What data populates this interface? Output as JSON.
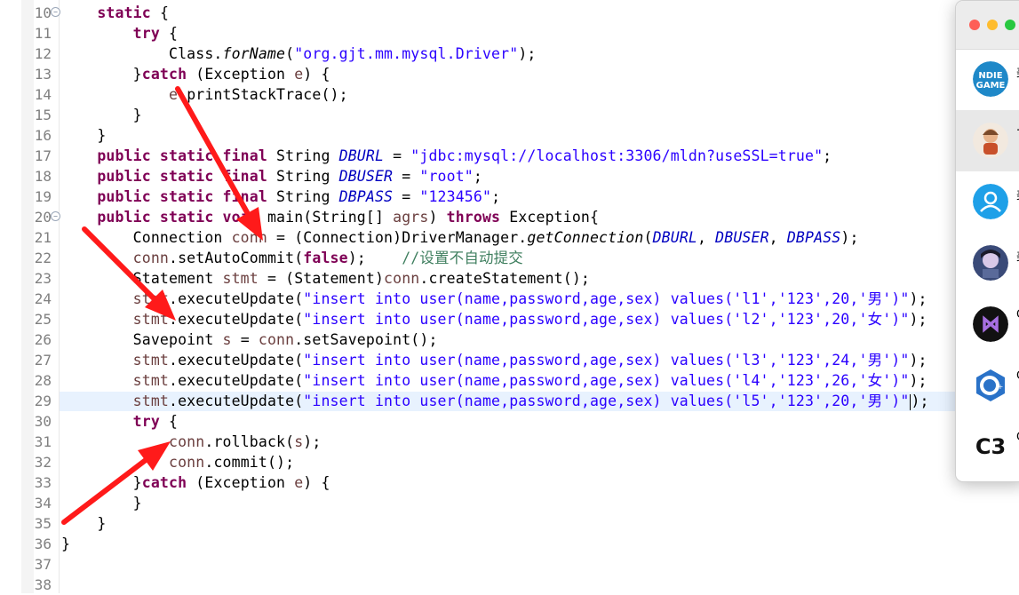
{
  "editor": {
    "line_numbers": [
      "10",
      "11",
      "12",
      "13",
      "14",
      "15",
      "16",
      "17",
      "18",
      "19",
      "20",
      "21",
      "22",
      "23",
      "24",
      "25",
      "26",
      "27",
      "28",
      "29",
      "30",
      "31",
      "32",
      "33",
      "34",
      "35",
      "36",
      "37",
      "38"
    ],
    "lines": [
      {
        "id": "l10",
        "segs": [
          {
            "t": "    "
          },
          {
            "t": "static",
            "c": "kw"
          },
          {
            "t": " {"
          }
        ]
      },
      {
        "id": "l11",
        "segs": [
          {
            "t": "        "
          },
          {
            "t": "try",
            "c": "kw"
          },
          {
            "t": " {"
          }
        ]
      },
      {
        "id": "l12",
        "segs": [
          {
            "t": "            Class."
          },
          {
            "t": "forName",
            "c": "mth"
          },
          {
            "t": "("
          },
          {
            "t": "\"org.gjt.mm.mysql.Driver\"",
            "c": "str"
          },
          {
            "t": ");"
          }
        ]
      },
      {
        "id": "l13",
        "segs": [
          {
            "t": "        }"
          },
          {
            "t": "catch",
            "c": "kw"
          },
          {
            "t": " (Exception "
          },
          {
            "t": "e",
            "c": "var"
          },
          {
            "t": ") {"
          }
        ]
      },
      {
        "id": "l14",
        "segs": [
          {
            "t": "            "
          },
          {
            "t": "e",
            "c": "var"
          },
          {
            "t": ".printStackTrace();"
          }
        ]
      },
      {
        "id": "l15",
        "segs": [
          {
            "t": "        }"
          }
        ]
      },
      {
        "id": "l16",
        "segs": [
          {
            "t": "    }"
          }
        ]
      },
      {
        "id": "l17",
        "segs": [
          {
            "t": "    "
          },
          {
            "t": "public static final",
            "c": "kw"
          },
          {
            "t": " String "
          },
          {
            "t": "DBURL",
            "c": "fld"
          },
          {
            "t": " = "
          },
          {
            "t": "\"jdbc:mysql://localhost:3306/mldn?useSSL=true\"",
            "c": "str"
          },
          {
            "t": ";"
          }
        ]
      },
      {
        "id": "l18",
        "segs": [
          {
            "t": "    "
          },
          {
            "t": "public static final",
            "c": "kw"
          },
          {
            "t": " String "
          },
          {
            "t": "DBUSER",
            "c": "fld"
          },
          {
            "t": " = "
          },
          {
            "t": "\"root\"",
            "c": "str"
          },
          {
            "t": ";"
          }
        ]
      },
      {
        "id": "l19",
        "segs": [
          {
            "t": "    "
          },
          {
            "t": "public static final",
            "c": "kw"
          },
          {
            "t": " String "
          },
          {
            "t": "DBPASS",
            "c": "fld"
          },
          {
            "t": " = "
          },
          {
            "t": "\"123456\"",
            "c": "str"
          },
          {
            "t": ";"
          }
        ]
      },
      {
        "id": "l20",
        "segs": [
          {
            "t": "    "
          },
          {
            "t": "public static void",
            "c": "kw"
          },
          {
            "t": " main(String[] "
          },
          {
            "t": "agrs",
            "c": "var"
          },
          {
            "t": ") "
          },
          {
            "t": "throws",
            "c": "kw"
          },
          {
            "t": " Exception{"
          }
        ]
      },
      {
        "id": "l21",
        "segs": [
          {
            "t": "        Connection "
          },
          {
            "t": "conn",
            "c": "var"
          },
          {
            "t": " = (Connection)DriverManager."
          },
          {
            "t": "getConnection",
            "c": "mth"
          },
          {
            "t": "("
          },
          {
            "t": "DBURL",
            "c": "fld"
          },
          {
            "t": ", "
          },
          {
            "t": "DBUSER",
            "c": "fld"
          },
          {
            "t": ", "
          },
          {
            "t": "DBPASS",
            "c": "fld"
          },
          {
            "t": ");"
          }
        ]
      },
      {
        "id": "l22",
        "segs": [
          {
            "t": "        "
          },
          {
            "t": "conn",
            "c": "var"
          },
          {
            "t": ".setAutoCommit("
          },
          {
            "t": "false",
            "c": "kw"
          },
          {
            "t": ");    "
          },
          {
            "t": "//设置不自动提交",
            "c": "cmt"
          }
        ]
      },
      {
        "id": "l23",
        "segs": [
          {
            "t": "        Statement "
          },
          {
            "t": "stmt",
            "c": "var"
          },
          {
            "t": " = (Statement)"
          },
          {
            "t": "conn",
            "c": "var"
          },
          {
            "t": ".createStatement();"
          }
        ]
      },
      {
        "id": "l24",
        "segs": [
          {
            "t": "        "
          },
          {
            "t": "stmt",
            "c": "var"
          },
          {
            "t": ".executeUpdate("
          },
          {
            "t": "\"insert into user(name,password,age,sex) values('l1','123',20,'男')\"",
            "c": "str"
          },
          {
            "t": ");"
          }
        ]
      },
      {
        "id": "l25",
        "segs": [
          {
            "t": "        "
          },
          {
            "t": "stmt",
            "c": "var"
          },
          {
            "t": ".executeUpdate("
          },
          {
            "t": "\"insert into user(name,password,age,sex) values('l2','123',20,'女')\"",
            "c": "str"
          },
          {
            "t": ");"
          }
        ]
      },
      {
        "id": "l26",
        "segs": [
          {
            "t": "        Savepoint "
          },
          {
            "t": "s",
            "c": "var"
          },
          {
            "t": " = "
          },
          {
            "t": "conn",
            "c": "var"
          },
          {
            "t": ".setSavepoint();"
          }
        ]
      },
      {
        "id": "l27",
        "segs": [
          {
            "t": "        "
          },
          {
            "t": "stmt",
            "c": "var"
          },
          {
            "t": ".executeUpdate("
          },
          {
            "t": "\"insert into user(name,password,age,sex) values('l3','123',24,'男')\"",
            "c": "str"
          },
          {
            "t": ");"
          }
        ]
      },
      {
        "id": "l28",
        "segs": [
          {
            "t": "        "
          },
          {
            "t": "stmt",
            "c": "var"
          },
          {
            "t": ".executeUpdate("
          },
          {
            "t": "\"insert into user(name,password,age,sex) values('l4','123',26,'女')\"",
            "c": "str"
          },
          {
            "t": ");"
          }
        ]
      },
      {
        "id": "l29",
        "segs": [
          {
            "t": "        "
          },
          {
            "t": "stmt",
            "c": "var"
          },
          {
            "t": ".executeUpdate("
          },
          {
            "t": "\"insert into user(name,password,age,sex) values('l5','123',20,'男')\"",
            "c": "str"
          },
          {
            "t": ");"
          }
        ]
      },
      {
        "id": "l30",
        "segs": [
          {
            "t": "        "
          },
          {
            "t": "try",
            "c": "kw"
          },
          {
            "t": " {"
          }
        ]
      },
      {
        "id": "l31",
        "segs": [
          {
            "t": "            "
          },
          {
            "t": "conn",
            "c": "var"
          },
          {
            "t": ".rollback("
          },
          {
            "t": "s",
            "c": "var"
          },
          {
            "t": ");"
          }
        ]
      },
      {
        "id": "l32",
        "segs": [
          {
            "t": "            "
          },
          {
            "t": "conn",
            "c": "var"
          },
          {
            "t": ".commit();"
          }
        ]
      },
      {
        "id": "l33",
        "segs": [
          {
            "t": "        }"
          },
          {
            "t": "catch",
            "c": "kw"
          },
          {
            "t": " (Exception "
          },
          {
            "t": "e",
            "c": "var"
          },
          {
            "t": ") {"
          }
        ]
      },
      {
        "id": "l34",
        "segs": [
          {
            "t": "        }"
          }
        ]
      },
      {
        "id": "l35",
        "segs": [
          {
            "t": "    }"
          }
        ]
      },
      {
        "id": "l36",
        "segs": [
          {
            "t": "}"
          }
        ]
      },
      {
        "id": "l37",
        "segs": [
          {
            "t": ""
          }
        ]
      },
      {
        "id": "l38",
        "segs": [
          {
            "t": ""
          }
        ]
      }
    ],
    "current_line": "29",
    "colors": {
      "keyword": "#7f0055",
      "string": "#2a00ff",
      "field": "#0000c0",
      "comment": "#3f7f5f",
      "local_var": "#6a3e3e",
      "line_highlight": "#e8f2fe",
      "arrow": "#ff1a1a"
    }
  },
  "chat_window": {
    "traffic_lights": {
      "close": "#fe5f57",
      "minimize": "#febc2e",
      "zoom": "#28c840"
    },
    "contacts": [
      {
        "icon": "indie-game-avatar",
        "preview": "美",
        "selected": false
      },
      {
        "icon": "cartoon-person-avatar",
        "preview": "·",
        "selected": true
      },
      {
        "icon": "people-icon-avatar",
        "preview": "美",
        "selected": false
      },
      {
        "icon": "anime-avatar",
        "preview": "美",
        "selected": false
      },
      {
        "icon": "visual-studio-avatar",
        "preview": "C",
        "selected": false
      },
      {
        "icon": "cpp-logo-avatar",
        "preview": "C",
        "selected": false
      },
      {
        "icon": "c3-logo-avatar",
        "preview": "C",
        "selected": false
      }
    ]
  }
}
